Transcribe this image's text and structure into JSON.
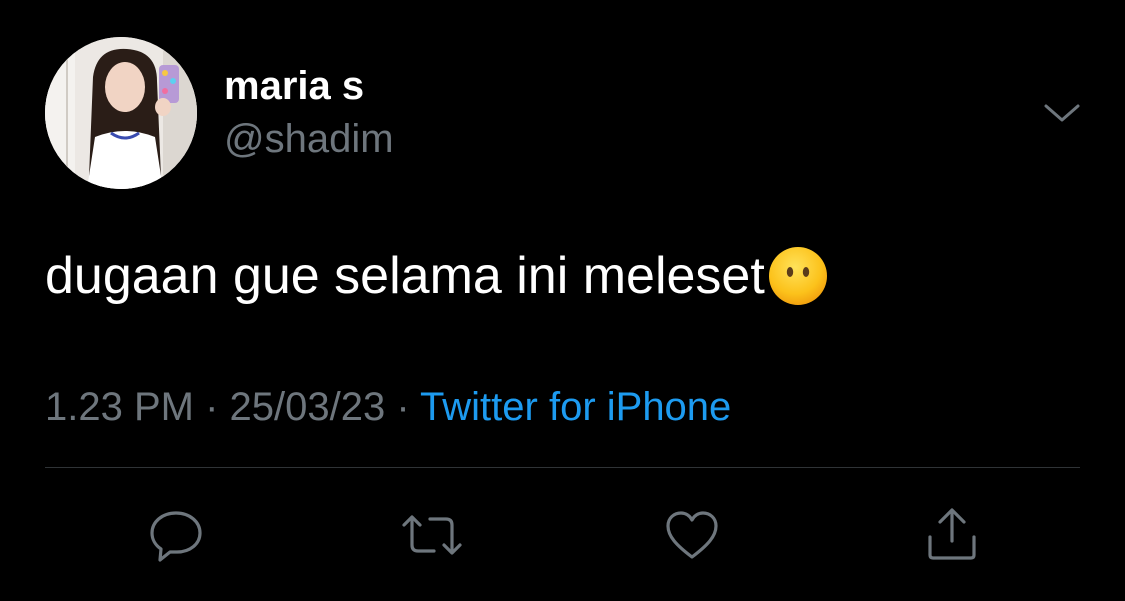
{
  "user": {
    "display_name": "maria s",
    "handle": "@shadim",
    "avatar_icon": "profile-photo"
  },
  "tweet": {
    "text": "dugaan gue selama ini meleset",
    "emoji_icon": "face-without-mouth-emoji"
  },
  "meta": {
    "time": "1.23 PM",
    "separator": " · ",
    "date": "25/03/23",
    "source": "Twitter for iPhone"
  },
  "actions": [
    {
      "icon": "reply-icon"
    },
    {
      "icon": "retweet-icon"
    },
    {
      "icon": "like-icon"
    },
    {
      "icon": "share-icon"
    }
  ],
  "colors": {
    "background": "#000000",
    "text": "#ffffff",
    "secondary": "#6e767d",
    "link": "#1d9bf0",
    "divider": "#2f3336"
  }
}
